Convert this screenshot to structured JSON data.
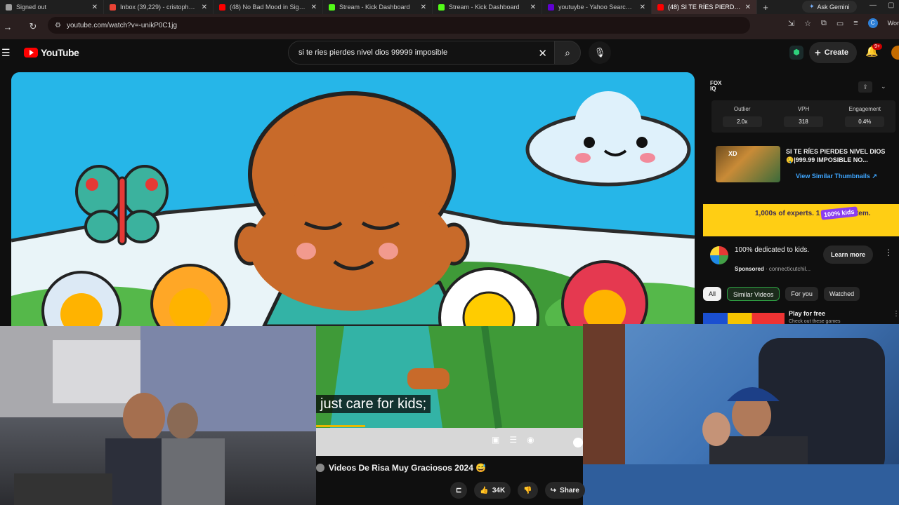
{
  "browser": {
    "tabs": [
      {
        "title": "Signed out",
        "color": "#9e9e9e"
      },
      {
        "title": "Inbox (39,229) - cristopher@",
        "color": "#ea4335"
      },
      {
        "title": "(48) No Bad Mood in Sight |",
        "color": "#ff0000"
      },
      {
        "title": "Stream - Kick Dashboard",
        "color": "#53fc18"
      },
      {
        "title": "Stream - Kick Dashboard",
        "color": "#53fc18"
      },
      {
        "title": "youtuybe - Yahoo Search Re",
        "color": "#6001d2"
      },
      {
        "title": "(48) SI TE RÍES PIERDES",
        "color": "#ff0000"
      }
    ],
    "new_tab": "+",
    "ask_gemini": "Ask Gemini",
    "url": "youtube.com/watch?v=-unikP0C1jg",
    "profile_initial": "C",
    "profile_label": "Wor"
  },
  "youtube": {
    "logo_text": "YouTube",
    "search_value": "si te ries pierdes nivel dios 99999 imposible",
    "create_label": "Create",
    "notif_badge": "9+"
  },
  "vidiq": {
    "logo": "FOX IQ",
    "stats": [
      {
        "label": "Outlier",
        "value": "2.0x"
      },
      {
        "label": "VPH",
        "value": "318"
      },
      {
        "label": "Engagement",
        "value": "0.4%"
      }
    ],
    "thumb_badge": "XD",
    "video_title": "SI TE RÍES PIERDES NIVEL DIOS 🤤|999.99 IMPOSIBLE NO...",
    "similar_link": "View Similar Thumbnails ↗"
  },
  "ad": {
    "banner_text": "1,000s of experts. 1 health system.",
    "banner_badge": "100% kids",
    "title": "100% dedicated to kids.",
    "sponsored": "Sponsored",
    "sponsor_name": "· connecticutchil...",
    "cta": "Learn more"
  },
  "chips": [
    "All",
    "Similar Videos",
    "For you",
    "Watched"
  ],
  "play_free": {
    "title": "Play for free",
    "subtitle": "Check out these games"
  },
  "player": {
    "caption": "just care for kids;",
    "video_title": "Videos De Risa Muy Graciosos 2024 😅",
    "likes": "34K",
    "share": "Share"
  },
  "colors": {
    "accent": "#ff0000",
    "sky": "#26b6e8",
    "link": "#3ea6ff"
  }
}
